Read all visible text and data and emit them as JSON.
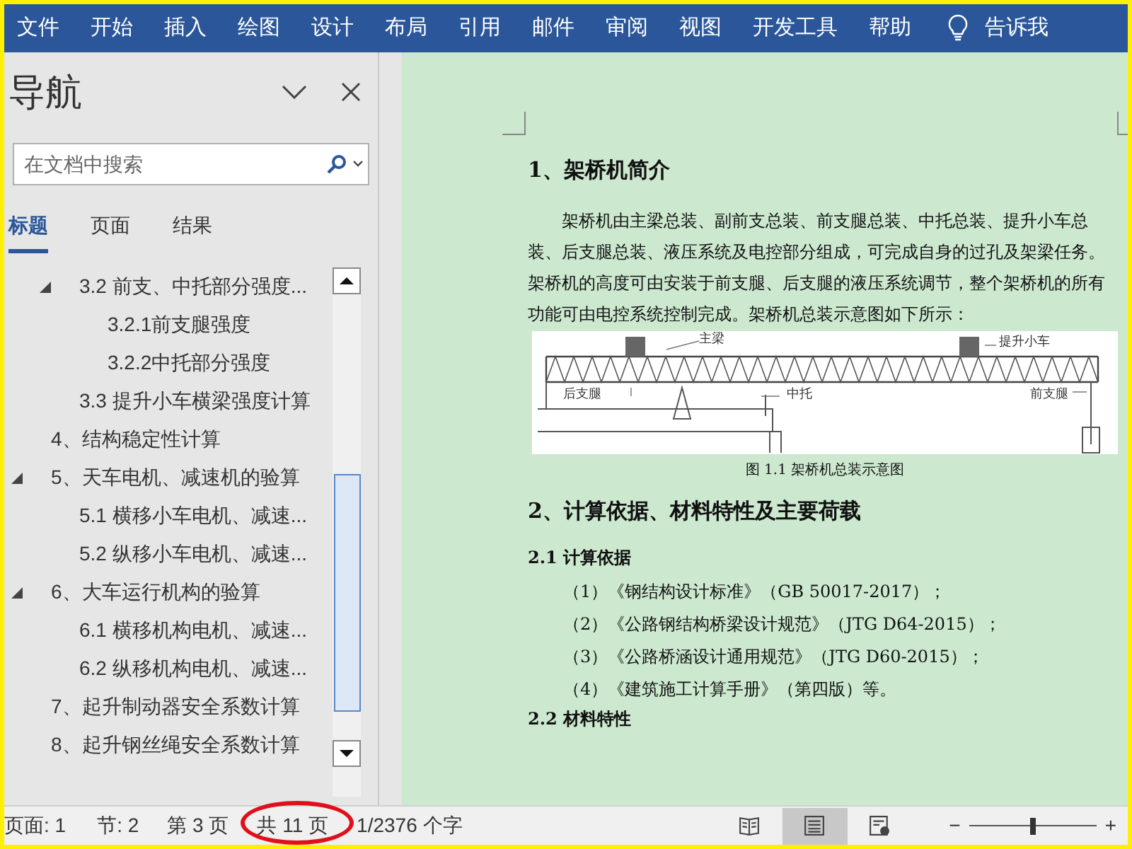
{
  "ribbon": {
    "tabs": [
      {
        "label": "文件"
      },
      {
        "label": "开始"
      },
      {
        "label": "插入"
      },
      {
        "label": "绘图"
      },
      {
        "label": "设计"
      },
      {
        "label": "布局"
      },
      {
        "label": "引用"
      },
      {
        "label": "邮件"
      },
      {
        "label": "审阅"
      },
      {
        "label": "视图"
      },
      {
        "label": "开发工具"
      },
      {
        "label": "帮助"
      }
    ],
    "tell_me": "告诉我"
  },
  "navigation": {
    "title": "导航",
    "search": {
      "placeholder": "在文档中搜索"
    },
    "tabs": [
      {
        "label": "标题",
        "selected": true
      },
      {
        "label": "页面",
        "selected": false
      },
      {
        "label": "结果",
        "selected": false
      }
    ],
    "tree": {
      "continued_children": [
        {
          "label": "3.2 前支、中托部分强度...",
          "expanded": true,
          "children": [
            {
              "label": "3.2.1前支腿强度"
            },
            {
              "label": "3.2.2中托部分强度"
            }
          ]
        },
        {
          "label": "3.3 提升小车横梁强度计算"
        }
      ],
      "items": [
        {
          "label": "4、结构稳定性计算"
        },
        {
          "label": "5、天车电机、减速机的验算",
          "expanded": true,
          "children": [
            {
              "label": "5.1 横移小车电机、减速..."
            },
            {
              "label": "5.2 纵移小车电机、减速..."
            }
          ]
        },
        {
          "label": "6、大车运行机构的验算",
          "expanded": true,
          "children": [
            {
              "label": "6.1 横移机构电机、减速..."
            },
            {
              "label": "6.2 纵移机构电机、减速..."
            }
          ]
        },
        {
          "label": "7、起升制动器安全系数计算"
        },
        {
          "label": "8、起升钢丝绳安全系数计算"
        }
      ]
    }
  },
  "document": {
    "blocks": [
      {
        "kind": "heading",
        "text": "1、架桥机简介"
      },
      {
        "kind": "paragraph",
        "text": "架桥机由主梁总装、副前支总装、前支腿总装、中托总装、提升小车总装、后支腿总装、液压系统及电控部分组成，可完成自身的过孔及架梁任务。架桥机的高度可由安装于前支腿、后支腿的液压系统调节，整个架桥机的所有功能可由电控系统控制完成。架桥机总装示意图如下所示："
      },
      {
        "kind": "figure",
        "labels": [
          "主梁",
          "提升小车",
          "后支腿",
          "中托",
          "前支腿"
        ],
        "caption": "图 1.1  架桥机总装示意图"
      },
      {
        "kind": "heading",
        "text": "2、计算依据、材料特性及主要荷载"
      },
      {
        "kind": "subheading",
        "text": "2.1  计算依据"
      },
      {
        "kind": "list_item",
        "text": "（1）《钢结构设计标准》（GB 50017-2017）；"
      },
      {
        "kind": "list_item",
        "text": "（2）《公路钢结构桥梁设计规范》（JTG D64-2015）；"
      },
      {
        "kind": "list_item",
        "text": "（3）《公路桥涵设计通用规范》（JTG D60-2015）；"
      },
      {
        "kind": "list_item",
        "text": "（4）《建筑施工计算手册》（第四版）等。"
      },
      {
        "kind": "subheading",
        "text": "2.2  材料特性"
      }
    ]
  },
  "status_bar": {
    "items": [
      {
        "text": "页面: 1",
        "circled": false
      },
      {
        "text": "节: 2",
        "circled": false
      },
      {
        "text": "第 3 页",
        "circled": false
      },
      {
        "text": "共 11 页",
        "circled": true
      },
      {
        "text": "1/2376 个字",
        "circled": false
      }
    ],
    "views": [
      {
        "kind": "read",
        "selected": false
      },
      {
        "kind": "print",
        "selected": true
      },
      {
        "kind": "web",
        "selected": false
      }
    ],
    "zoom": {
      "minus": "−",
      "plus": "+",
      "level": 0.5
    }
  }
}
